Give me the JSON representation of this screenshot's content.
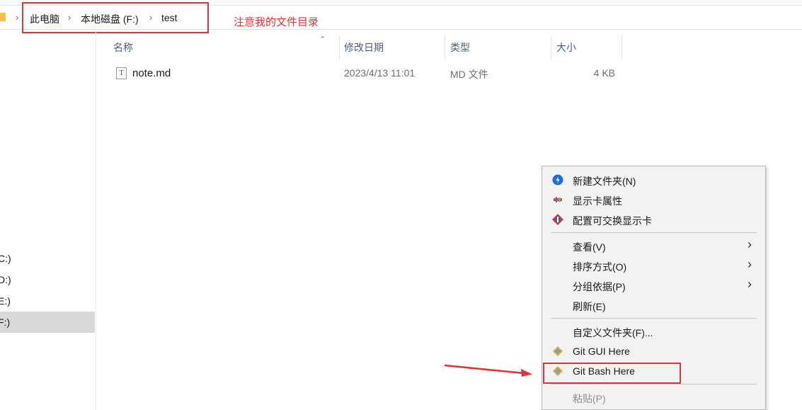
{
  "address_bar": {
    "breadcrumbs": [
      "此电脑",
      "本地磁盘 (F:)",
      "test"
    ]
  },
  "annotation": {
    "note": "注意我的文件目录"
  },
  "nav_pane": {
    "drives": [
      "C:)",
      "D:)",
      "E:)",
      "F:)"
    ],
    "selected": "F:)"
  },
  "columns": {
    "name": "名称",
    "date": "修改日期",
    "type": "类型",
    "size": "大小"
  },
  "files": [
    {
      "name": "note.md",
      "date": "2023/4/13 11:01",
      "type": "MD 文件",
      "size": "4 KB",
      "icon": "text-file-icon",
      "icon_letter": "T"
    }
  ],
  "context_menu": {
    "items": [
      {
        "label": "新建文件夹(N)",
        "icon": "new-folder-icon"
      },
      {
        "label": "显示卡属性",
        "icon": "display-card-icon"
      },
      {
        "label": "配置可交换显示卡",
        "icon": "gpu-switch-icon"
      },
      {
        "label": "查看(V)",
        "submenu": true
      },
      {
        "label": "排序方式(O)",
        "submenu": true
      },
      {
        "label": "分组依据(P)",
        "submenu": true
      },
      {
        "label": "刷新(E)"
      },
      {
        "label": "自定义文件夹(F)..."
      },
      {
        "label": "Git GUI Here",
        "icon": "git-icon"
      },
      {
        "label": "Git Bash Here",
        "icon": "git-icon",
        "highlighted": true
      },
      {
        "label": "粘贴(P)",
        "disabled": true
      }
    ]
  },
  "colors": {
    "annotation_red": "#e0323a",
    "header_text": "#4c607a",
    "selected_drive_bg": "#d9d9d9",
    "menu_bg": "#f2f2f2"
  }
}
